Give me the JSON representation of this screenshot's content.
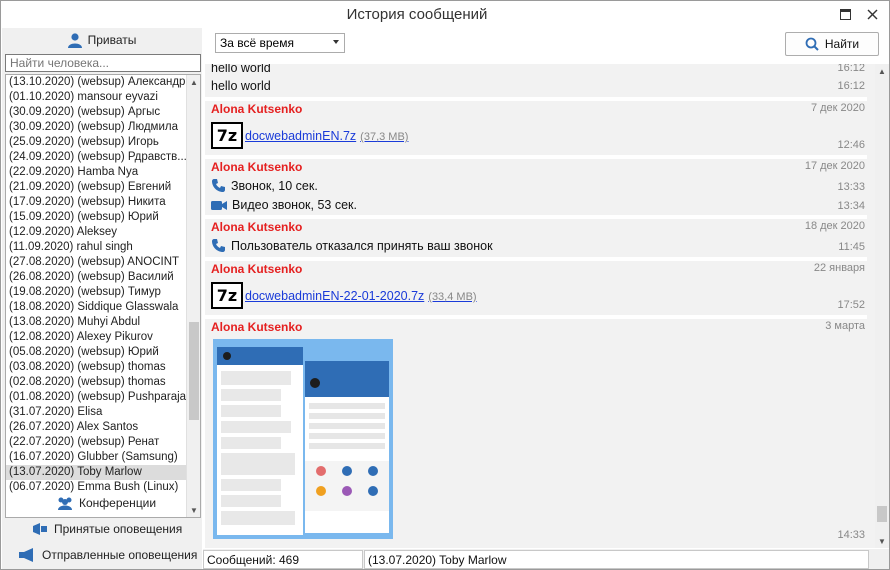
{
  "window": {
    "title": "История сообщений"
  },
  "sidebar": {
    "privates_label": "Приваты",
    "search_placeholder": "Найти человека...",
    "contacts": [
      "(13.10.2020) (websup) Александр",
      "(01.10.2020) mansour eyvazi",
      "(30.09.2020) (websup) Аргыс",
      "(30.09.2020) (websup) Людмила",
      "(25.09.2020) (websup) Игорь",
      "(24.09.2020) (websup) Рдравств...",
      "(22.09.2020) Hamba Nya",
      "(21.09.2020) (websup) Евгений",
      "(17.09.2020) (websup) Никита",
      "(15.09.2020) (websup) Юрий",
      "(12.09.2020) Aleksey",
      "(11.09.2020) rahul singh",
      "(27.08.2020) (websup) ANOCINT",
      "(26.08.2020) (websup) Василий",
      "(19.08.2020) (websup) Тимур",
      "(18.08.2020) Siddique Glasswala",
      "(13.08.2020) Muhyi Abdul",
      "(12.08.2020) Alexey Pikurov",
      "(05.08.2020) (websup) Юрий",
      "(03.08.2020) (websup) thomas",
      "(02.08.2020) (websup) thomas",
      "(01.08.2020) (websup) Pushparaja",
      "(31.07.2020) Elisa",
      "(26.07.2020) Alex Santos",
      "(22.07.2020) (websup) Ренат",
      "(16.07.2020) Glubber (Samsung)",
      "(13.07.2020) Toby Marlow",
      "(06.07.2020) Emma Bush (Linux)"
    ],
    "selected_index": 26,
    "conferences_label": "Конференции",
    "received_label": "Принятые оповещения",
    "sent_label": "Отправленные оповещения"
  },
  "toolbar": {
    "period_value": "За всё время",
    "find_label": "Найти"
  },
  "messages": {
    "top_lines": [
      {
        "text": "hello world",
        "time": "16:12"
      },
      {
        "text": "hello world",
        "time": "16:12"
      }
    ],
    "blocks": [
      {
        "sender": "Alona Kutsenko",
        "date": "7 дек 2020",
        "file_name": "docwebadminEN.7z",
        "file_size": "(37,3 MB)",
        "time": "12:46"
      },
      {
        "sender": "Alona Kutsenko",
        "date": "17 дек 2020",
        "call": "Звонок, 10 сек.",
        "call_time": "13:33",
        "video": "Видео звонок, 53 сек.",
        "video_time": "13:34"
      },
      {
        "sender": "Alona Kutsenko",
        "date": "18 дек 2020",
        "rejected": "Пользователь отказался принять ваш звонок",
        "time": "11:45"
      },
      {
        "sender": "Alona Kutsenko",
        "date": "22 января",
        "file_name": "docwebadminEN-22-01-2020.7z",
        "file_size": "(33,4 MB)",
        "time": "17:52"
      },
      {
        "sender": "Alona Kutsenko",
        "date": "3 марта",
        "time": "14:33"
      }
    ],
    "file_icon_text": "7z"
  },
  "status": {
    "count": "Сообщений: 469",
    "contact": "(13.07.2020) Toby Marlow"
  },
  "colors": {
    "sender": "#e52020",
    "link": "#1a3bd9",
    "accent": "#2f6db5"
  }
}
